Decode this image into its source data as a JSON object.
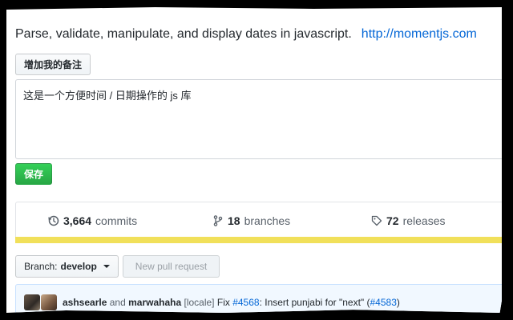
{
  "repo": {
    "description": "Parse, validate, manipulate, and display dates in javascript.",
    "homepage": "http://momentjs.com"
  },
  "note": {
    "add_button": "增加我的备注",
    "text": "这是一个方便时间 / 日期操作的 js 库",
    "save_button": "保存"
  },
  "summary": {
    "commits_count": "3,664",
    "commits_label": "commits",
    "branches_count": "18",
    "branches_label": "branches",
    "releases_count": "72",
    "releases_label": "releases"
  },
  "language_bar": {
    "color": "#f1e05a",
    "fraction": 1.0
  },
  "toolbar": {
    "branch_prefix": "Branch:",
    "branch_name": "develop",
    "new_pr": "New pull request"
  },
  "latest_commit": {
    "author1": "ashsearle",
    "and": "and",
    "author2": "marwahaha",
    "tag": "[locale]",
    "fix_word": "Fix",
    "issue_ref": "#4568",
    "message": ": Insert punjabi for \"next\" (",
    "pr_ref": "#4583",
    "close_paren": ")"
  },
  "icons": {
    "commits": "history-icon",
    "branches": "git-branch-icon",
    "releases": "tag-icon",
    "branch_dropdown": "chevron-down-icon"
  },
  "colors": {
    "link": "#0366d6",
    "save_button": "#28a745",
    "commit_bar_bg": "#f1f8ff"
  }
}
